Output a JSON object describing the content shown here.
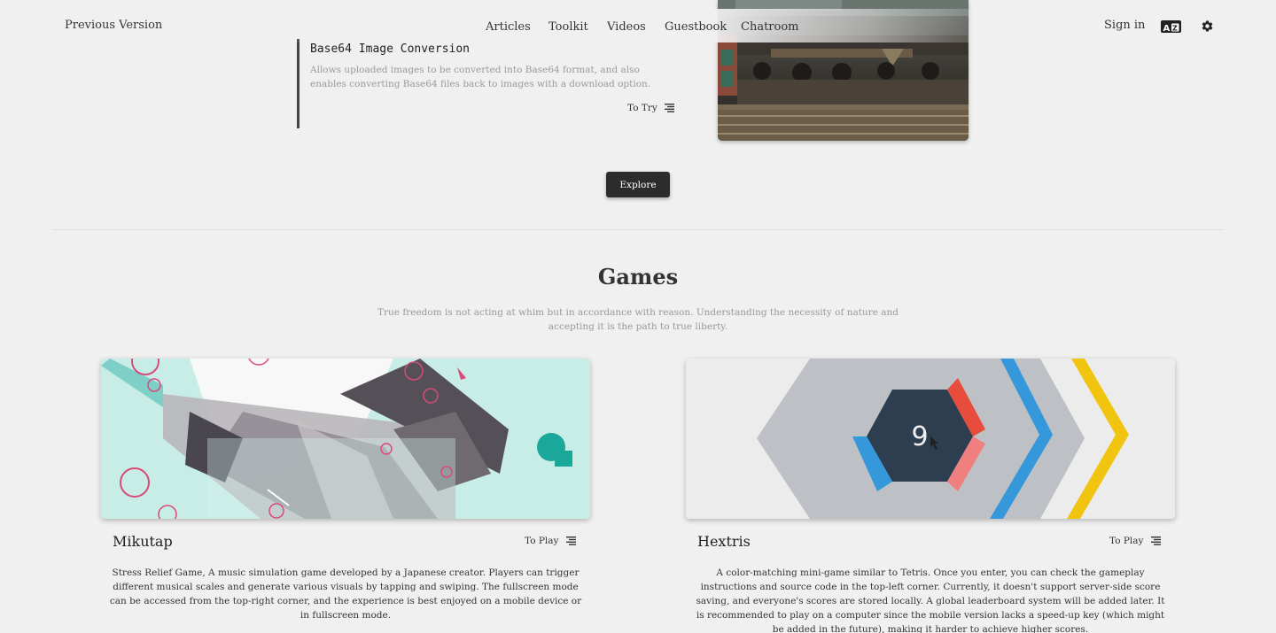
{
  "header": {
    "previous_version": "Previous Version",
    "nav": [
      "Articles",
      "Toolkit",
      "Videos",
      "Guestbook",
      "Chatroom"
    ],
    "sign_in": "Sign in",
    "icons": {
      "language": "translate-icon",
      "settings": "gear-icon"
    }
  },
  "feature": {
    "title": "Base64 Image Conversion",
    "description": "Allows uploaded images to be converted into Base64 format, and also enables converting Base64 files back to images with a download option.",
    "cta": "To Try",
    "cta_icon": "list-icon",
    "image": "train-model-image"
  },
  "explore": {
    "label": "Explore"
  },
  "games": {
    "title": "Games",
    "subtitle": "True freedom is not acting at whim but in accordance with reason. Understanding the necessity of nature and accepting it is the path to true liberty.",
    "items": [
      {
        "name": "Mikutap",
        "cta": "To Play",
        "description": "Stress Relief Game, A music simulation game developed by a Japanese creator. Players can trigger different musical scales and generate various visuals by tapping and swiping. The fullscreen mode can be accessed from the top-right corner, and the experience is best enjoyed on a mobile device or in fullscreen mode."
      },
      {
        "name": "Hextris",
        "cta": "To Play",
        "score": "9",
        "description": "A color-matching mini-game similar to Tetris. Once you enter, you can check the gameplay instructions and source code in the top-left corner. Currently, it doesn't support server-side score saving, and everyone's scores are stored locally. A global leaderboard system will be added later. It is recommended to play on a computer since the mobile version lacks a speed-up key (which might be added in the future), making it harder to achieve higher scores."
      }
    ]
  },
  "colors": {
    "background": "#f0f0f0",
    "button": "#2c2c2c",
    "mikutap_bg": "#c8ece6",
    "hextris_red": "#e74c3c",
    "hextris_blue": "#3498db",
    "hextris_yellow": "#f1c40f",
    "hextris_dark": "#2c3e50"
  }
}
